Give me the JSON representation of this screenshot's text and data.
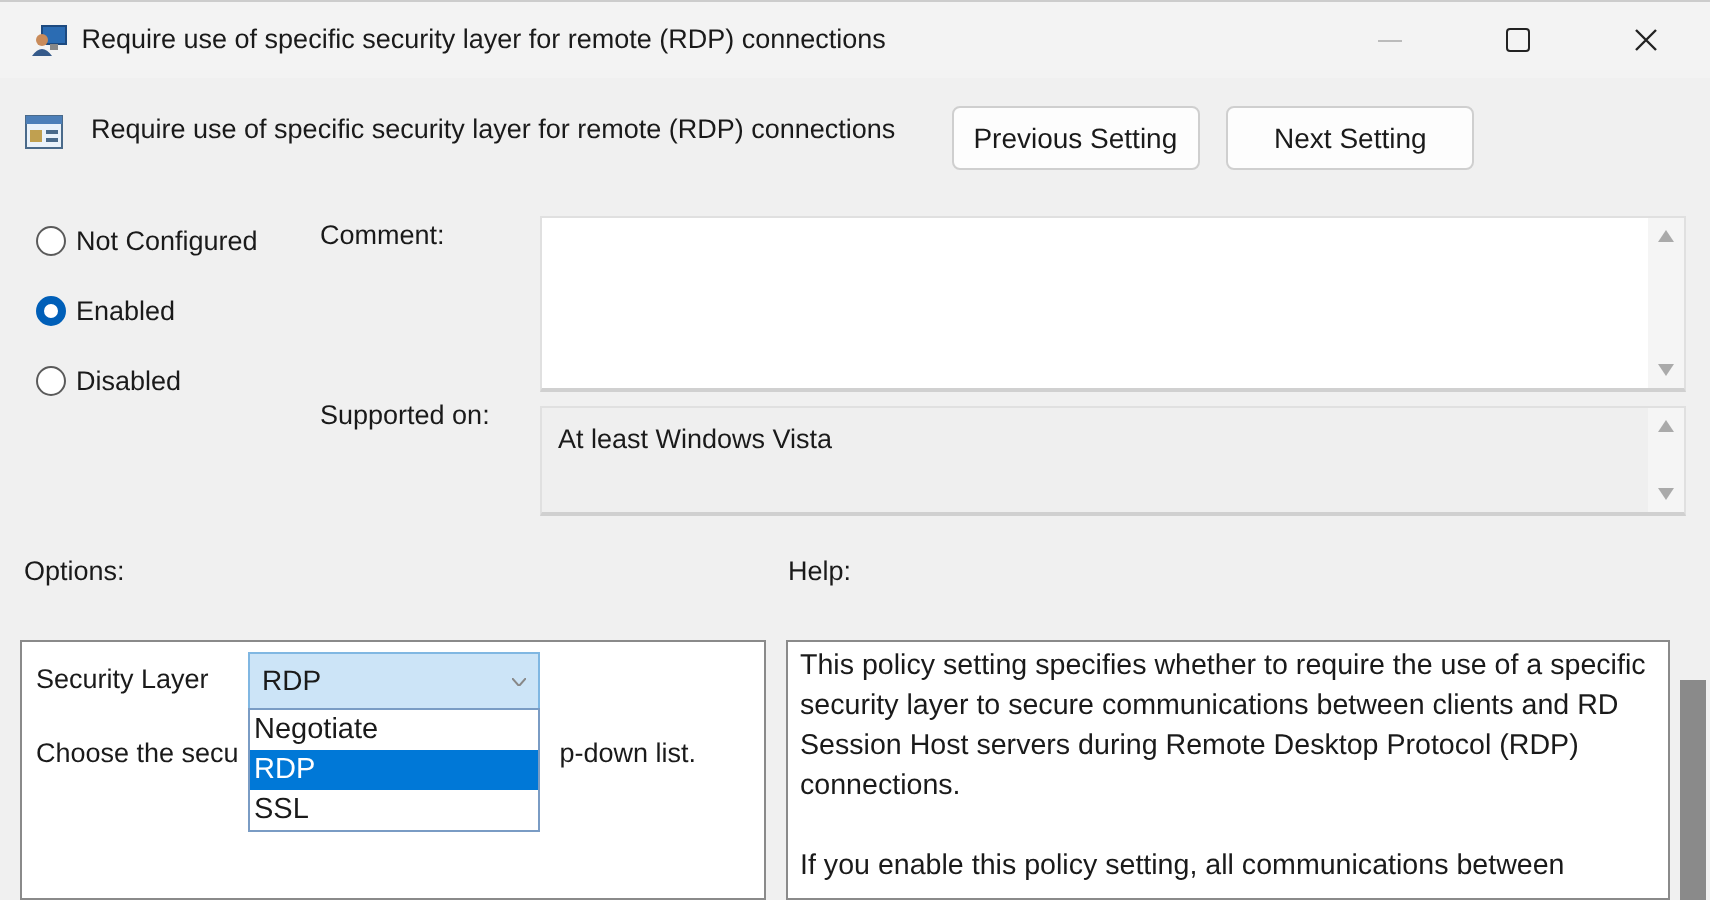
{
  "window": {
    "title": "Require use of specific security layer for remote (RDP) connections"
  },
  "header": {
    "title": "Require use of specific security layer for remote (RDP) connections",
    "buttons": [
      "Previous Setting",
      "Next Setting"
    ]
  },
  "state_options": [
    {
      "label": "Not Configured",
      "selected": false
    },
    {
      "label": "Enabled",
      "selected": true
    },
    {
      "label": "Disabled",
      "selected": false
    }
  ],
  "comment": {
    "label": "Comment:"
  },
  "supported_on": {
    "label": "Supported on:",
    "value": "At least Windows Vista"
  },
  "options": {
    "label": "Options:",
    "field_label": "Security Layer",
    "value": "RDP",
    "dropdown_items": [
      {
        "label": "Negotiate",
        "selected": false
      },
      {
        "label": "RDP",
        "selected": true
      },
      {
        "label": "SSL",
        "selected": false
      }
    ],
    "text_before": "Choose the secu",
    "text_after": "p-down list."
  },
  "help": {
    "label": "Help:",
    "paragraphs": [
      "This policy setting specifies whether to require the use of a specific security layer to secure communications between clients and RD Session Host servers during Remote Desktop Protocol (RDP) connections.",
      "If you enable this policy setting, all communications between"
    ]
  }
}
